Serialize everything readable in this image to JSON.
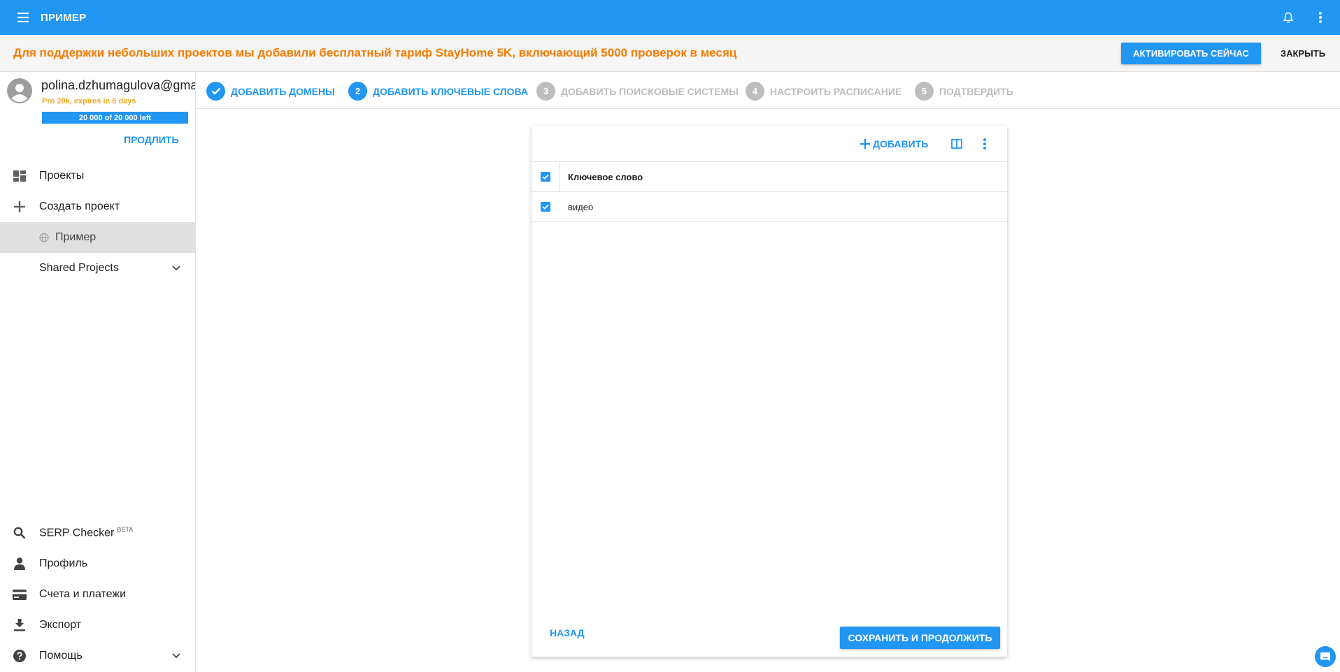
{
  "appbar": {
    "title": "ПРИМЕР",
    "menu_icon": "hamburger-menu-icon",
    "bell_icon": "bell-icon",
    "more_icon": "more-vert-icon"
  },
  "banner": {
    "message": "Для поддержки небольших проектов мы добавили бесплатный тариф StayHome 5K, включающий 5000 проверок в месяц",
    "activate_label": "АКТИВИРОВАТЬ СЕЙЧАС",
    "close_label": "ЗАКРЫТЬ"
  },
  "user": {
    "email": "polina.dzhumagulova@gma",
    "plan": "Pro 20k, expires in 6 days",
    "quota": "20 000 of 20 000 left",
    "extend_label": "ПРОДЛИТЬ"
  },
  "sidebar": {
    "items": [
      {
        "label": "Проекты",
        "icon": "dashboard-icon"
      },
      {
        "label": "Создать проект",
        "icon": "plus-icon"
      },
      {
        "label": "Пример",
        "icon": "globe-icon"
      },
      {
        "label": "Shared Projects",
        "icon": "chevron-down-icon"
      }
    ],
    "bottom": [
      {
        "label": "SERP Checker",
        "sup": "BETA",
        "icon": "search-icon"
      },
      {
        "label": "Профиль",
        "icon": "person-icon"
      },
      {
        "label": "Счета и платежи",
        "icon": "credit-card-icon"
      },
      {
        "label": "Экспорт",
        "icon": "download-icon"
      },
      {
        "label": "Помощь",
        "icon": "help-icon"
      }
    ]
  },
  "stepper": {
    "steps": [
      {
        "num": "1",
        "label": "ДОБАВИТЬ ДОМЕНЫ",
        "state": "done"
      },
      {
        "num": "2",
        "label": "ДОБАВИТЬ КЛЮЧЕВЫЕ СЛОВА",
        "state": "current"
      },
      {
        "num": "3",
        "label": "ДОБАВИТЬ ПОИСКОВЫЕ СИСТЕМЫ",
        "state": "pending"
      },
      {
        "num": "4",
        "label": "НАСТРОИТЬ РАСПИСАНИЕ",
        "state": "pending"
      },
      {
        "num": "5",
        "label": "ПОДТВЕРДИТЬ",
        "state": "pending"
      }
    ]
  },
  "card": {
    "add_label": "ДОБАВИТЬ",
    "table": {
      "header": "Ключевое слово",
      "rows": [
        "видео"
      ]
    },
    "back_label": "НАЗАД",
    "save_label": "СОХРАНИТЬ И ПРОДОЛЖИТЬ"
  },
  "colors": {
    "primary": "#2196f3",
    "banner_text": "#f57c00",
    "plan_text": "#f9a825",
    "pending": "#bdbdbd"
  }
}
